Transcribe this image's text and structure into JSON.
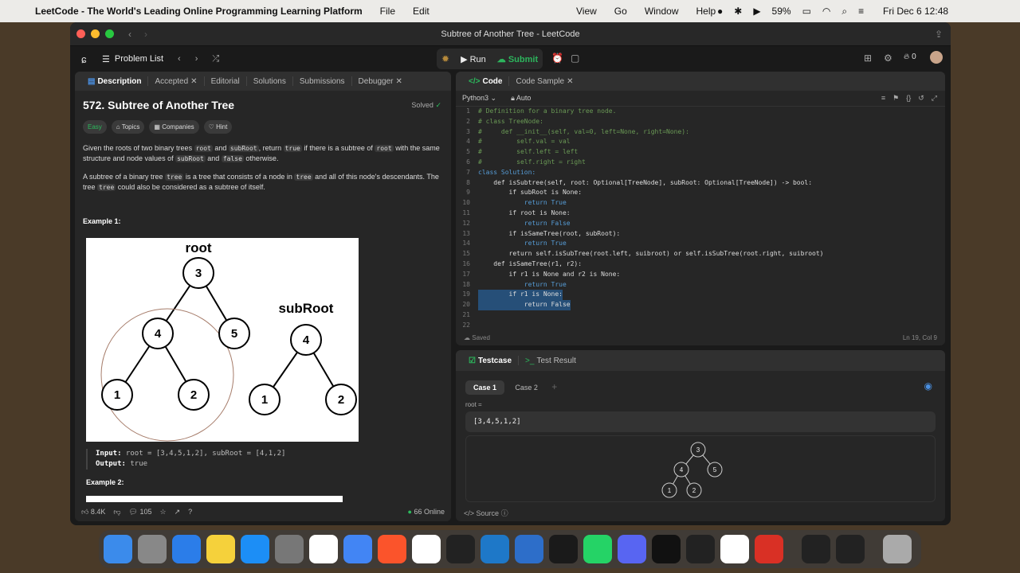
{
  "menubar": {
    "app": "LeetCode - The World's Leading Online Programming Learning Platform",
    "menus": [
      "File",
      "Edit"
    ],
    "right_menus": [
      "View",
      "Go",
      "Window",
      "Help"
    ],
    "battery": "59%",
    "clock": "Fri Dec 6  12:48"
  },
  "window": {
    "title": "Subtree of Another Tree - LeetCode"
  },
  "nav": {
    "problem_list": "Problem List",
    "run": "Run",
    "submit": "Submit",
    "fire_count": "0"
  },
  "left_tabs": [
    "Description",
    "Accepted",
    "Editorial",
    "Solutions",
    "Submissions",
    "Debugger"
  ],
  "problem": {
    "title": "572. Subtree of Another Tree",
    "solved": "Solved",
    "tags": [
      "Easy",
      "Topics",
      "Companies",
      "Hint"
    ],
    "p1": [
      "Given the roots of two binary trees ",
      "root",
      " and ",
      "subRoot",
      ", return ",
      "true",
      " if there is a subtree of ",
      "root",
      " with the same structure and node values of ",
      "subRoot",
      " and ",
      "false",
      " otherwise."
    ],
    "p2": [
      "A subtree of a binary tree ",
      "tree",
      " is a tree that consists of a node in ",
      "tree",
      " and all of this node's descendants. The tree ",
      "tree",
      " could also be considered as a subtree of itself."
    ],
    "example1": "Example 1:",
    "img_root": "root",
    "img_subroot": "subRoot",
    "img_nodes_root": [
      "3",
      "4",
      "5",
      "1",
      "2"
    ],
    "img_nodes_sub": [
      "4",
      "1",
      "2"
    ],
    "input_label": "Input:",
    "input_val": " root = [3,4,5,1,2], subRoot = [4,1,2]",
    "output_label": "Output:",
    "output_val": " true",
    "example2": "Example 2:"
  },
  "left_bottom": {
    "likes": "8.4K",
    "comments": "105",
    "online": "66 Online"
  },
  "code_tabs": [
    "Code",
    "Code Sample"
  ],
  "lang": "Python3",
  "auto": "Auto",
  "code_lines": [
    {
      "n": "1",
      "t": "# Definition for a binary tree node.",
      "c": "cm"
    },
    {
      "n": "2",
      "t": "# class TreeNode:",
      "c": "cm"
    },
    {
      "n": "3",
      "t": "#     def __init__(self, val=0, left=None, right=None):",
      "c": "cm"
    },
    {
      "n": "4",
      "t": "#         self.val = val",
      "c": "cm"
    },
    {
      "n": "5",
      "t": "#         self.left = left",
      "c": "cm"
    },
    {
      "n": "6",
      "t": "#         self.right = right",
      "c": "cm"
    },
    {
      "n": "7",
      "t": "class Solution:",
      "c": "kw"
    },
    {
      "n": "8",
      "t": "    def isSubtree(self, root: Optional[TreeNode], subRoot: Optional[TreeNode]) -> bool:",
      "c": "lt"
    },
    {
      "n": "9",
      "t": "        if subRoot is None:",
      "c": "lt"
    },
    {
      "n": "10",
      "t": "            return True",
      "c": "bl"
    },
    {
      "n": "11",
      "t": "        if root is None:",
      "c": "lt"
    },
    {
      "n": "12",
      "t": "            return False",
      "c": "bl"
    },
    {
      "n": "13",
      "t": "        if isSameTree(root, subRoot):",
      "c": "lt"
    },
    {
      "n": "14",
      "t": "            return True",
      "c": "bl"
    },
    {
      "n": "15",
      "t": "        return self.isSubTree(root.left, suibroot) or self.isSubTree(root.right, suibroot)",
      "c": "lt"
    },
    {
      "n": "16",
      "t": "    def isSameTree(r1, r2):",
      "c": "lt"
    },
    {
      "n": "17",
      "t": "        if r1 is None and r2 is None:",
      "c": "lt"
    },
    {
      "n": "18",
      "t": "            return True",
      "c": "bl"
    },
    {
      "n": "19",
      "t": "        if r1 is None:",
      "c": "sel"
    },
    {
      "n": "20",
      "t": "            return False",
      "c": "sel"
    },
    {
      "n": "21",
      "t": "",
      "c": "lt"
    },
    {
      "n": "22",
      "t": "",
      "c": "lt"
    }
  ],
  "code_status": {
    "saved": "Saved",
    "pos": "Ln 19, Col 9"
  },
  "test_tabs": [
    "Testcase",
    "Test Result"
  ],
  "cases": [
    "Case 1",
    "Case 2"
  ],
  "root_label": "root =",
  "root_value": "[3,4,5,1,2]",
  "mini_nodes": [
    "3",
    "4",
    "5",
    "1",
    "2"
  ],
  "source": "Source",
  "dock": [
    "Finder",
    "Launchpad",
    "Safari",
    "Notes",
    "App Store",
    "Settings",
    "Gmail",
    "Docs",
    "Brave",
    "Google",
    "Terminal",
    "VS Code",
    "Arc",
    "LeetCode",
    "WhatsApp",
    "Discord",
    "GitHub",
    "ChatGPT",
    "Chrome",
    "Slides",
    "Activity",
    "Screen",
    "Trash"
  ]
}
